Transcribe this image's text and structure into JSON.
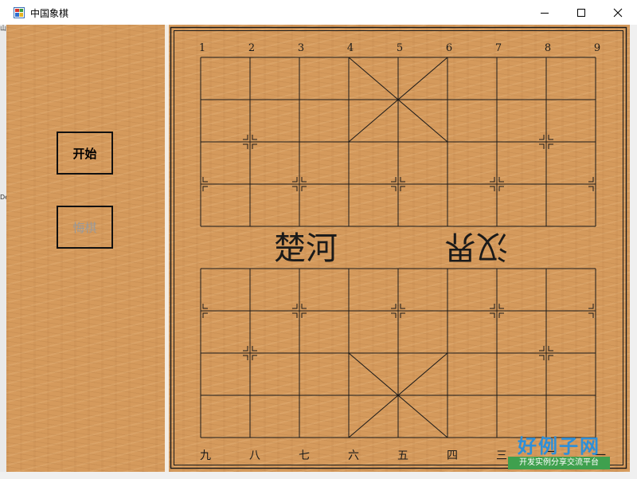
{
  "window": {
    "title": "中国象棋",
    "controls": {
      "minimize_icon": "minimize-icon",
      "maximize_icon": "maximize-icon",
      "close_icon": "close-icon"
    }
  },
  "side_panel": {
    "start_label": "开始",
    "undo_label": "悔棋",
    "edge_fragment_top": "山",
    "edge_fragment": "De"
  },
  "board": {
    "top_file_labels": [
      "1",
      "2",
      "3",
      "4",
      "5",
      "6",
      "7",
      "8",
      "9"
    ],
    "bottom_file_labels": [
      "九",
      "八",
      "七",
      "六",
      "五",
      "四",
      "三",
      "二",
      "一"
    ],
    "river_left": "楚河",
    "river_right": "汉界"
  },
  "watermark": {
    "title": "好例子网",
    "subtitle": "开发实例分享交流平台"
  },
  "colors": {
    "wood": "#d59a5c",
    "line": "#1a1a1a",
    "watermark_blue": "#2e8fd8",
    "watermark_green": "#3fa04e"
  }
}
